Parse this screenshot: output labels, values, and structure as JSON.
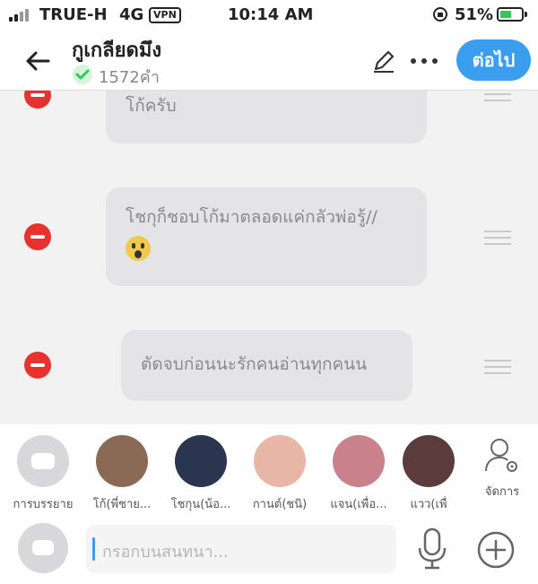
{
  "status": {
    "carrier": "TRUE-H",
    "network": "4G",
    "vpn": "VPN",
    "time": "10:14 AM",
    "battery": "51%",
    "battery_level": 0.51
  },
  "header": {
    "title": "กูเกลียดมึง",
    "word_count": "1572คำ",
    "next_label": "ต่อไป"
  },
  "messages": [
    {
      "text": "โก้ครับ"
    },
    {
      "text": "โชกุก็ชอบโก้มาตลอดแค่กลัวพ่อรู้//",
      "emoji": "scream-emoji"
    },
    {
      "text": "ตัดจบก่อนนะรักคนอ่านทุกคนน"
    }
  ],
  "characters": [
    {
      "name": "การบรรยาย",
      "type": "narration"
    },
    {
      "name": "โก้(พี่ชาย...",
      "color": "#8b6a55"
    },
    {
      "name": "โชกุน(น้อ...",
      "color": "#2b3550"
    },
    {
      "name": "กานต์(ชนิ)",
      "color": "#e7b6a6"
    },
    {
      "name": "แจน(เพื่อ...",
      "color": "#c9828c"
    },
    {
      "name": "แวว(เพื่",
      "color": "#5b3b3b"
    }
  ],
  "settings_label": "จัดการ",
  "input": {
    "placeholder": "กรอกบนสนทนา..."
  },
  "colors": {
    "accent": "#3a9dee",
    "delete": "#e8322e"
  }
}
